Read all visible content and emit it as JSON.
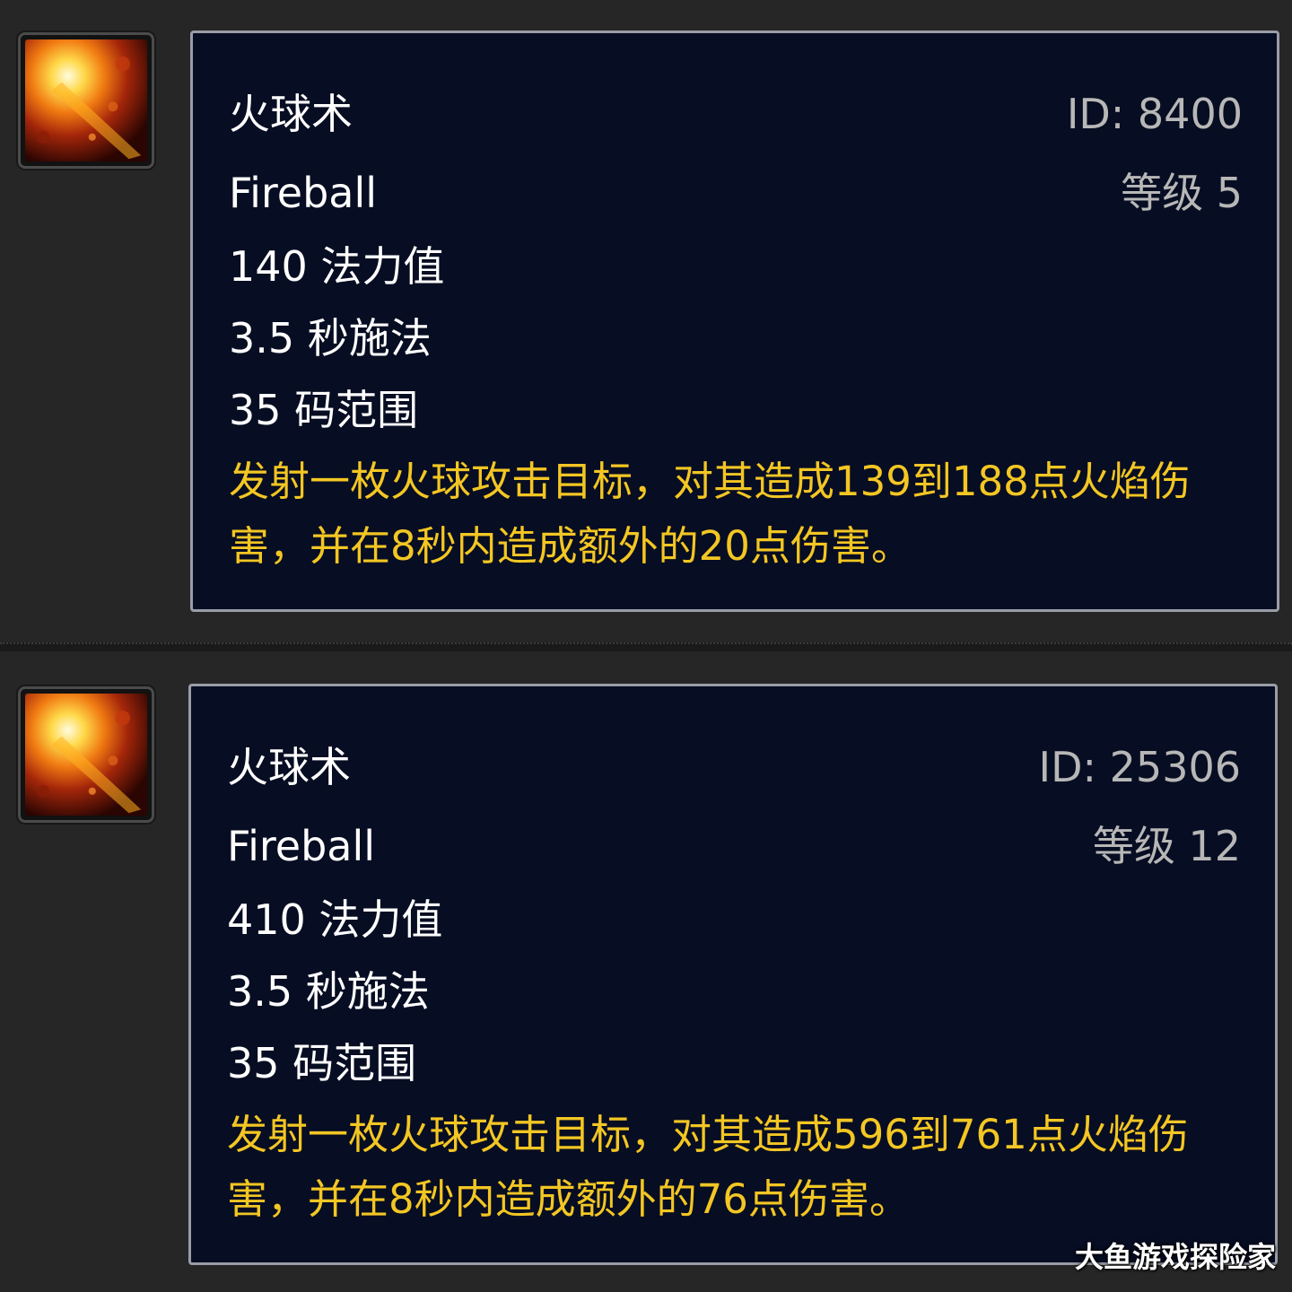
{
  "spells": [
    {
      "name_cn": "火球术",
      "name_en": "Fireball",
      "id": "ID: 8400",
      "level": "等级 5",
      "mana": "140 法力值",
      "cast": "3.5 秒施法",
      "range": "35 码范围",
      "description": "发射一枚火球攻击目标，对其造成139到188点火焰伤害，并在8秒内造成额外的20点伤害。",
      "icon": "fireball-icon"
    },
    {
      "name_cn": "火球术",
      "name_en": "Fireball",
      "id": "ID: 25306",
      "level": "等级 12",
      "mana": "410 法力值",
      "cast": "3.5 秒施法",
      "range": "35 码范围",
      "description": "发射一枚火球攻击目标，对其造成596到761点火焰伤害，并在8秒内造成额外的76点伤害。",
      "icon": "fireball-icon"
    }
  ],
  "watermark": "大鱼游戏探险家",
  "colors": {
    "tooltip_bg": "#070d22",
    "tooltip_border": "#9a9da6",
    "name_text": "#ffffff",
    "meta_text": "#b7b7b7",
    "description_text": "#f3c623"
  }
}
